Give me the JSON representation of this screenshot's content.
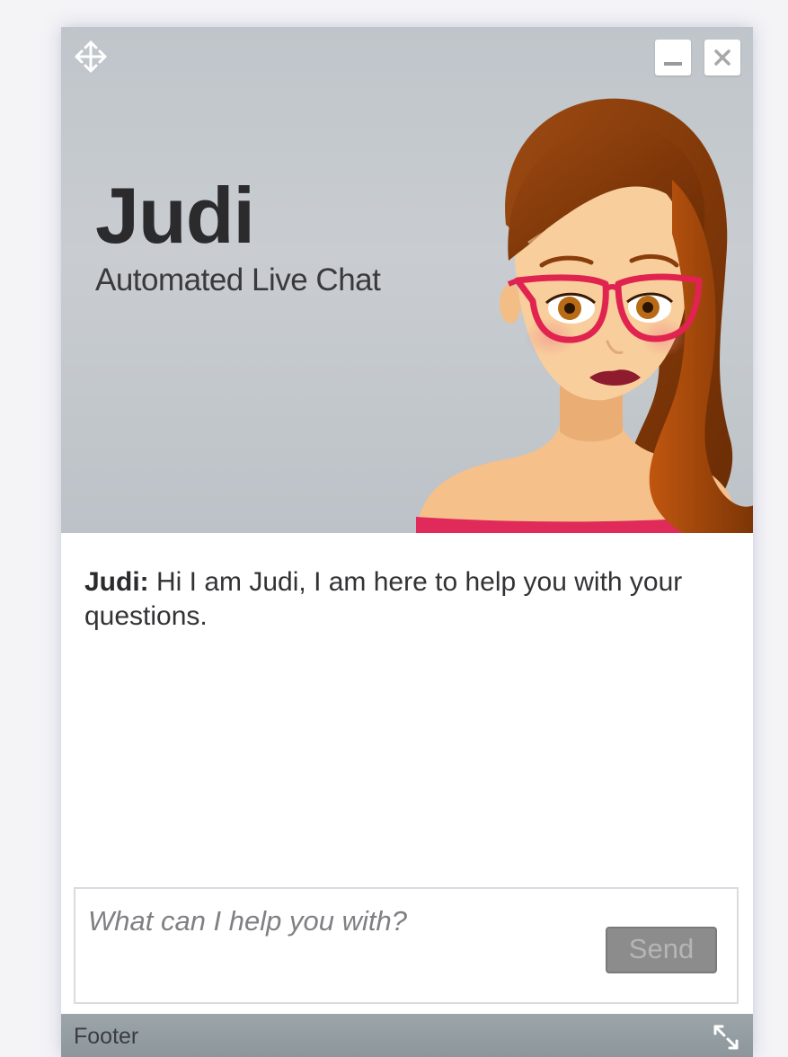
{
  "header": {
    "agent_name": "Judi",
    "subtitle": "Automated Live Chat",
    "move_icon": "move-arrows-icon",
    "minimize_icon": "minimize-icon",
    "close_icon": "close-icon",
    "avatar": "avatar-illustration"
  },
  "messages": [
    {
      "sender": "Judi:",
      "text": "Hi I am Judi, I am here to help you with your questions."
    }
  ],
  "input": {
    "placeholder": "What can I help you with?",
    "value": "",
    "send_label": "Send"
  },
  "footer": {
    "label": "Footer",
    "resize_icon": "expand-arrows-icon"
  },
  "colors": {
    "header_bg": "#c4c9cd",
    "footer_bg": "#949ea3",
    "send_bg": "#8c8c8c",
    "text_dark": "#2b2b2e",
    "glasses": "#e0234f",
    "hair": "#8a3d0c",
    "shirt": "#e02a5a"
  }
}
